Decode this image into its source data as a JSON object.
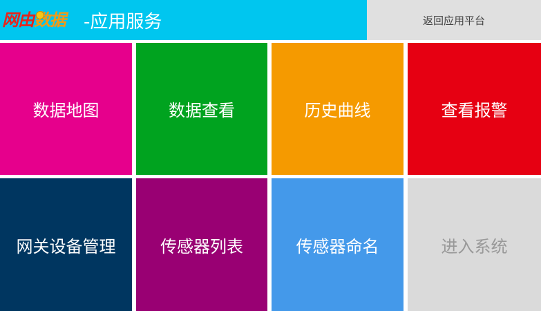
{
  "header": {
    "logo_part1": "网由",
    "logo_part2": "数据",
    "title": "-应用服务",
    "return_label": "返回应用平台"
  },
  "tiles": [
    {
      "label": "数据地图",
      "bg": "#e6008c",
      "fg": "#ffffff"
    },
    {
      "label": "数据查看",
      "bg": "#00a31f",
      "fg": "#ffffff"
    },
    {
      "label": "历史曲线",
      "bg": "#f59a00",
      "fg": "#ffffff"
    },
    {
      "label": "查看报警",
      "bg": "#e60012",
      "fg": "#ffffff"
    },
    {
      "label": "网关设备管理",
      "bg": "#003660",
      "fg": "#ffffff"
    },
    {
      "label": "传感器列表",
      "bg": "#990073",
      "fg": "#ffffff"
    },
    {
      "label": "传感器命名",
      "bg": "#4499ea",
      "fg": "#ffffff"
    },
    {
      "label": "进入系统",
      "bg": "#dadada",
      "fg": "#999999"
    }
  ],
  "colors": {
    "header_bg": "#00c6ef",
    "return_bg": "#e0e0e0"
  }
}
